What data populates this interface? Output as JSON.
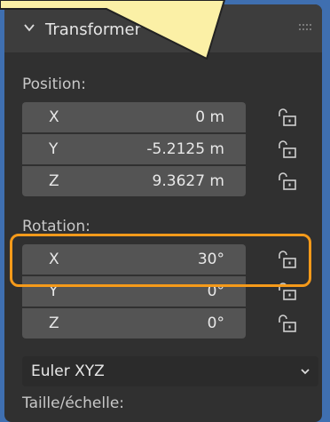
{
  "panel": {
    "title": "Transformer",
    "title_icon": "chevron-down-icon",
    "grip_icon": "drag-grip-icon"
  },
  "position": {
    "label": "Position:",
    "fields": [
      {
        "axis": "X",
        "value": "0 m"
      },
      {
        "axis": "Y",
        "value": "-5.2125 m"
      },
      {
        "axis": "Z",
        "value": "9.3627 m"
      }
    ]
  },
  "rotation": {
    "label": "Rotation:",
    "fields": [
      {
        "axis": "X",
        "value": "30°"
      },
      {
        "axis": "Y",
        "value": "0°"
      },
      {
        "axis": "Z",
        "value": "0°"
      }
    ],
    "mode": "Euler XYZ"
  },
  "scale": {
    "label": "Taille/échelle:"
  },
  "annotation": {
    "highlight_color": "#f59a1a",
    "callout_color": "#fbf0a6"
  }
}
